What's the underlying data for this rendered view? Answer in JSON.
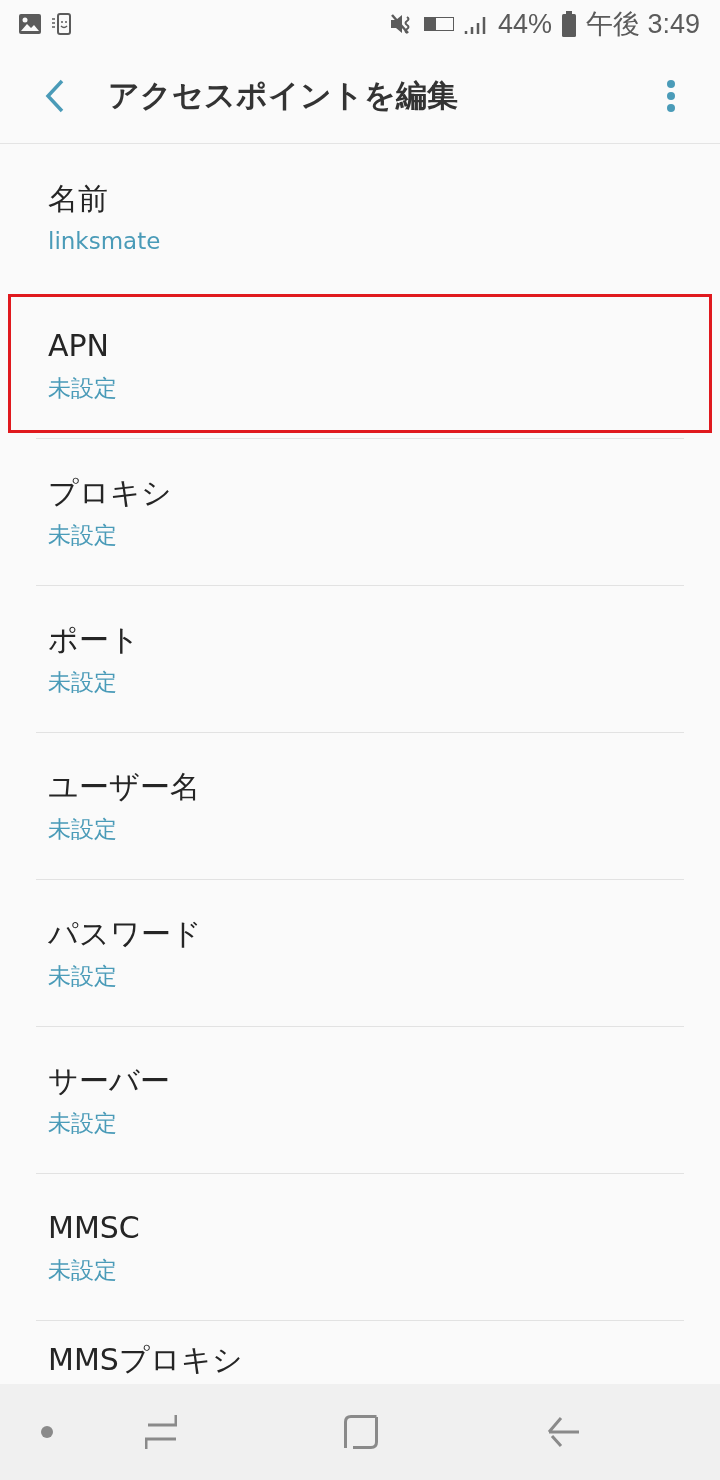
{
  "status_bar": {
    "battery": "44%",
    "time": "午後 3:49"
  },
  "app_bar": {
    "title": "アクセスポイントを編集"
  },
  "settings": [
    {
      "title": "名前",
      "value": "linksmate",
      "highlighted": false
    },
    {
      "title": "APN",
      "value": "未設定",
      "highlighted": true
    },
    {
      "title": "プロキシ",
      "value": "未設定",
      "highlighted": false
    },
    {
      "title": "ポート",
      "value": "未設定",
      "highlighted": false
    },
    {
      "title": "ユーザー名",
      "value": "未設定",
      "highlighted": false
    },
    {
      "title": "パスワード",
      "value": "未設定",
      "highlighted": false
    },
    {
      "title": "サーバー",
      "value": "未設定",
      "highlighted": false
    },
    {
      "title": "MMSC",
      "value": "未設定",
      "highlighted": false
    },
    {
      "title": "MMSプロキシ",
      "highlighted": false
    }
  ]
}
